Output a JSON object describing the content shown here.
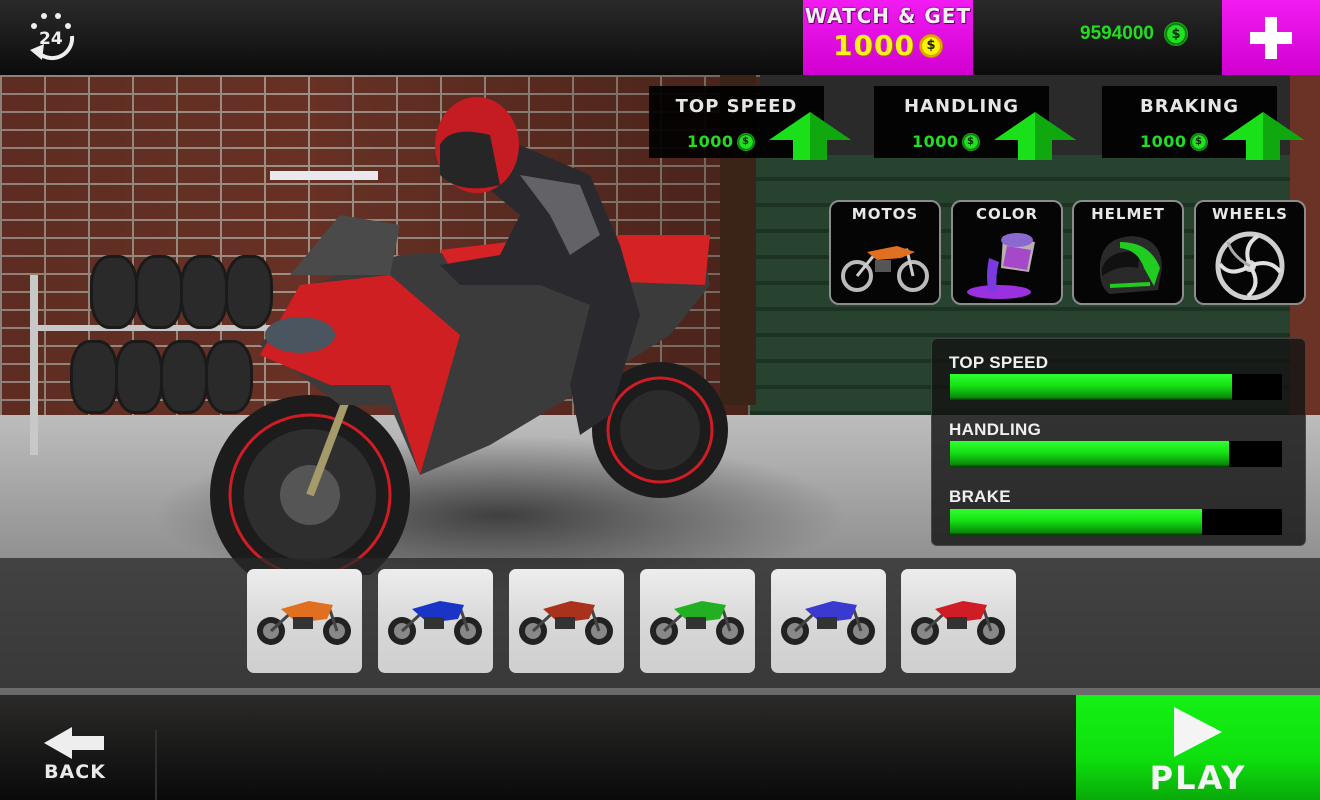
{
  "topbar": {
    "daily_reward_icon": "24h-refresh-icon",
    "watch": {
      "title": "WATCH & GET",
      "amount": "1000",
      "coin_symbol": "$"
    },
    "balance": {
      "value": "9594000",
      "coin_symbol": "$"
    },
    "add_coins_icon": "plus-icon"
  },
  "upgrades": [
    {
      "label": "TOP SPEED",
      "price": "1000",
      "coin_symbol": "$",
      "icon": "arrow-up-icon"
    },
    {
      "label": "HANDLING",
      "price": "1000",
      "coin_symbol": "$",
      "icon": "arrow-up-icon"
    },
    {
      "label": "BRAKING",
      "price": "1000",
      "coin_symbol": "$",
      "icon": "arrow-up-icon"
    }
  ],
  "categories": [
    {
      "label": "MOTOS",
      "icon": "dirt-bike-icon"
    },
    {
      "label": "COLOR",
      "icon": "paint-bucket-icon"
    },
    {
      "label": "HELMET",
      "icon": "helmet-icon"
    },
    {
      "label": "WHEELS",
      "icon": "wheel-rim-icon"
    }
  ],
  "stats": [
    {
      "label": "TOP SPEED",
      "fill_percent": 85
    },
    {
      "label": "HANDLING",
      "fill_percent": 84
    },
    {
      "label": "BRAKE",
      "fill_percent": 76
    }
  ],
  "bikes": [
    {
      "name": "dirt-bike",
      "color": "#e0701f"
    },
    {
      "name": "sport-bike-blue",
      "color": "#1a34c8"
    },
    {
      "name": "cruiser-red",
      "color": "#a8321c"
    },
    {
      "name": "sport-bike-green",
      "color": "#22b022"
    },
    {
      "name": "cruiser-blue",
      "color": "#3a3ad0"
    },
    {
      "name": "sport-bike-red",
      "color": "#d01c24"
    }
  ],
  "bottombar": {
    "back_label": "BACK",
    "play_label": "PLAY"
  },
  "colors": {
    "magenta": "#e010e0",
    "green": "#14e014",
    "coin_gold": "#fff200",
    "bike_red": "#d01c24"
  }
}
